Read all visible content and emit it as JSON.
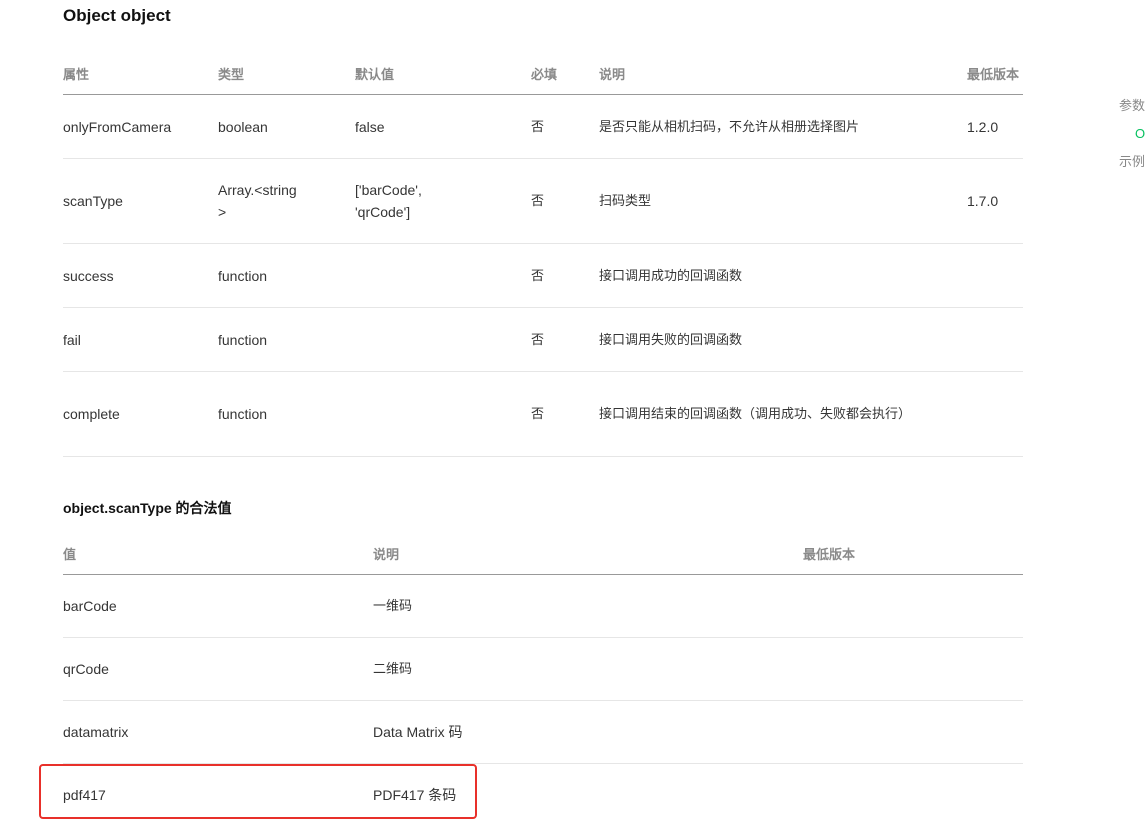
{
  "object_section": {
    "title": "Object object",
    "headers": [
      "属性",
      "类型",
      "默认值",
      "必填",
      "说明",
      "最低版本"
    ],
    "rows": [
      {
        "name": "onlyFromCamera",
        "type": "boolean",
        "default": "false",
        "required": "否",
        "desc": "是否只能从相机扫码，不允许从相册选择图片",
        "version": "1.2.0"
      },
      {
        "name": "scanType",
        "type": "Array.<string>",
        "default": "['barCode', 'qrCode']",
        "required": "否",
        "desc": "扫码类型",
        "version": "1.7.0"
      },
      {
        "name": "success",
        "type": "function",
        "default": "",
        "required": "否",
        "desc": "接口调用成功的回调函数",
        "version": ""
      },
      {
        "name": "fail",
        "type": "function",
        "default": "",
        "required": "否",
        "desc": "接口调用失败的回调函数",
        "version": ""
      },
      {
        "name": "complete",
        "type": "function",
        "default": "",
        "required": "否",
        "desc": "接口调用结束的回调函数（调用成功、失败都会执行）",
        "version": ""
      }
    ]
  },
  "scantype_section": {
    "title": "object.scanType 的合法值",
    "headers": [
      "值",
      "说明",
      "最低版本"
    ],
    "rows": [
      {
        "value": "barCode",
        "desc": "一维码",
        "version": ""
      },
      {
        "value": "qrCode",
        "desc": "二维码",
        "version": ""
      },
      {
        "value": "datamatrix",
        "desc": "Data Matrix 码",
        "version": ""
      },
      {
        "value": "pdf417",
        "desc": "PDF417 条码",
        "version": ""
      }
    ]
  },
  "right_nav": {
    "items": [
      "参数",
      "O",
      "示例"
    ]
  },
  "colors": {
    "accent_green": "#07c160",
    "highlight_red": "#e8302a"
  }
}
